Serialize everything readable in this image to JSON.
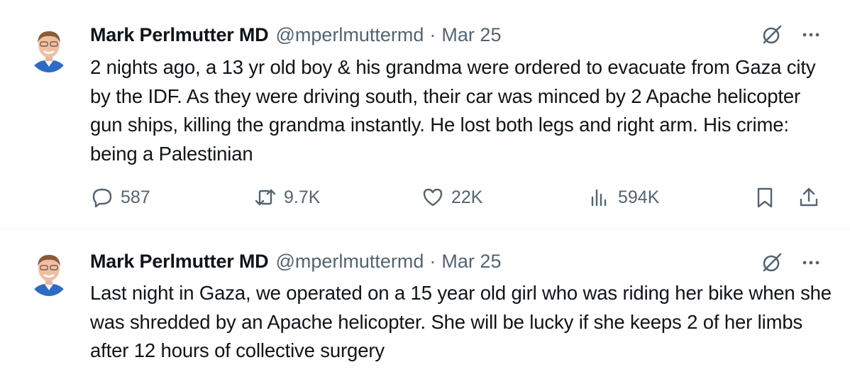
{
  "tweets": [
    {
      "author_name": "Mark Perlmutter MD",
      "handle": "@mperlmuttermd",
      "separator": "·",
      "date": "Mar 25",
      "text": "2 nights ago, a 13 yr old boy & his grandma were ordered to evacuate from Gaza city by the IDF. As they were driving south, their car was minced by 2 Apache helicopter gun ships, killing the grandma instantly. He lost both legs and right arm. His crime: being a Palestinian",
      "stats": {
        "replies": "587",
        "reposts": "9.7K",
        "likes": "22K",
        "views": "594K"
      }
    },
    {
      "author_name": "Mark Perlmutter MD",
      "handle": "@mperlmuttermd",
      "separator": "·",
      "date": "Mar 25",
      "text": "Last night in Gaza, we operated on a 15 year old girl who was riding her bike when she was shredded by an Apache helicopter. She will be lucky if she keeps 2 of her limbs after 12 hours of collective surgery"
    }
  ],
  "icons": {
    "reply": "reply-icon",
    "repost": "repost-icon",
    "like": "like-icon",
    "views": "views-icon",
    "bookmark": "bookmark-icon",
    "share": "share-icon",
    "grok": "grok-icon",
    "more": "more-icon"
  },
  "colors": {
    "text": "#0f1419",
    "secondary": "#536471",
    "divider": "#eff3f4",
    "scrubs": "#2d6bc4"
  }
}
